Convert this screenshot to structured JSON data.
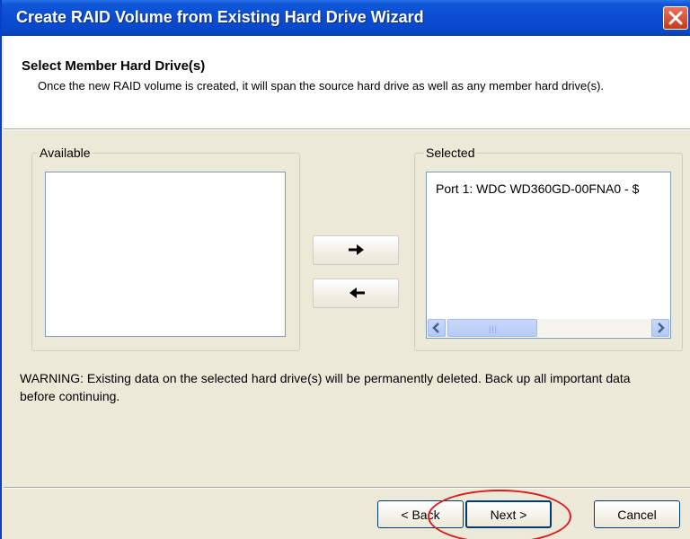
{
  "window": {
    "title": "Create RAID Volume from Existing Hard Drive Wizard"
  },
  "header": {
    "title": "Select Member Hard Drive(s)",
    "description": "Once the new RAID volume is created, it will span the source hard drive as well as any member hard drive(s)."
  },
  "available": {
    "label": "Available",
    "items": []
  },
  "selected": {
    "label": "Selected",
    "items": [
      "Port 1: WDC WD360GD-00FNA0 - $"
    ]
  },
  "buttons": {
    "add_icon": "arrow-right-icon",
    "remove_icon": "arrow-left-icon",
    "back_label": "< Back",
    "next_label": "Next >",
    "cancel_label": "Cancel"
  },
  "warning": "WARNING: Existing data on the selected hard drive(s) will be permanently deleted. Back up all important data before continuing.",
  "colors": {
    "title_bar": "#0a4bd1",
    "dialog_bg": "#ece9d8",
    "highlight_circle": "#d81e1e"
  }
}
